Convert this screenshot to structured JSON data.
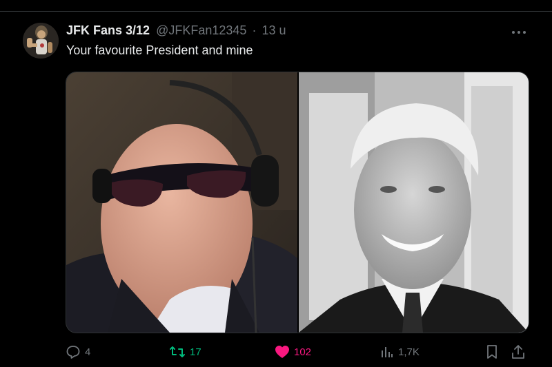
{
  "tweet": {
    "author_name": "JFK Fans 3/12",
    "handle": "@JFKFan12345",
    "separator": "·",
    "time": "13 u",
    "text": "Your favourite President and mine"
  },
  "actions": {
    "replies": "4",
    "retweets": "17",
    "likes": "102",
    "views": "1,7K"
  },
  "colors": {
    "background": "#000000",
    "retweet_active": "#00ba7c",
    "like_active": "#f91880",
    "muted": "#71767b"
  },
  "icons": [
    "more-icon",
    "reply-icon",
    "retweet-icon",
    "heart-icon",
    "views-icon",
    "bookmark-icon",
    "share-icon"
  ]
}
